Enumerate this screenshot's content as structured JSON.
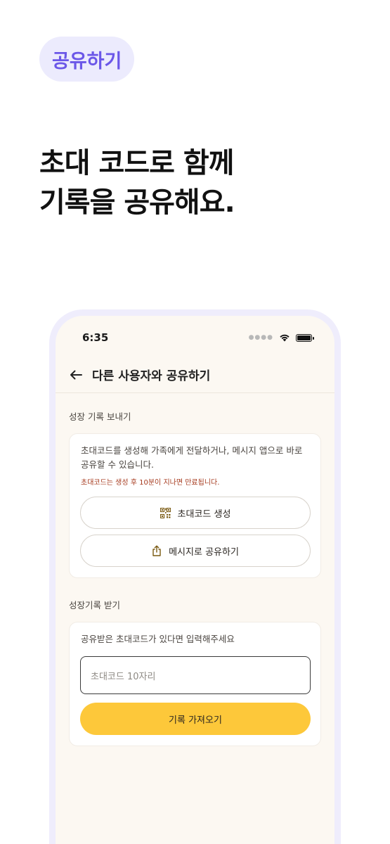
{
  "promo": {
    "pill_label": "공유하기",
    "headline_line1": "초대 코드로 함께",
    "headline_line2": "기록을 공유해요."
  },
  "status_bar": {
    "time": "6:35"
  },
  "app_bar": {
    "title": "다른 사용자와 공유하기"
  },
  "send_section": {
    "label": "성장 기록 보내기",
    "description": "초대코드를 생성해 가족에게 전달하거나, 메시지 앱으로 바로 공유할 수 있습니다.",
    "warning": "초대코드는 생성 후 10분이 지나면 만료됩니다.",
    "generate_button": "초대코드 생성",
    "share_button": "메시지로 공유하기"
  },
  "receive_section": {
    "label": "성장기록 받기",
    "description": "공유받은 초대코드가 있다면 입력해주세요",
    "input_placeholder": "초대코드 10자리",
    "import_button": "기록 가져오기"
  },
  "colors": {
    "accent_purple": "#6b57e8",
    "pill_bg": "#ecebfd",
    "primary_yellow": "#fdc83a",
    "warning_red": "#a63a1e",
    "screen_bg": "#fcf8f2"
  },
  "icons": {
    "back": "arrow-left-icon",
    "generate": "qr-code-icon",
    "share": "share-icon",
    "wifi": "wifi-icon",
    "battery": "battery-icon"
  }
}
